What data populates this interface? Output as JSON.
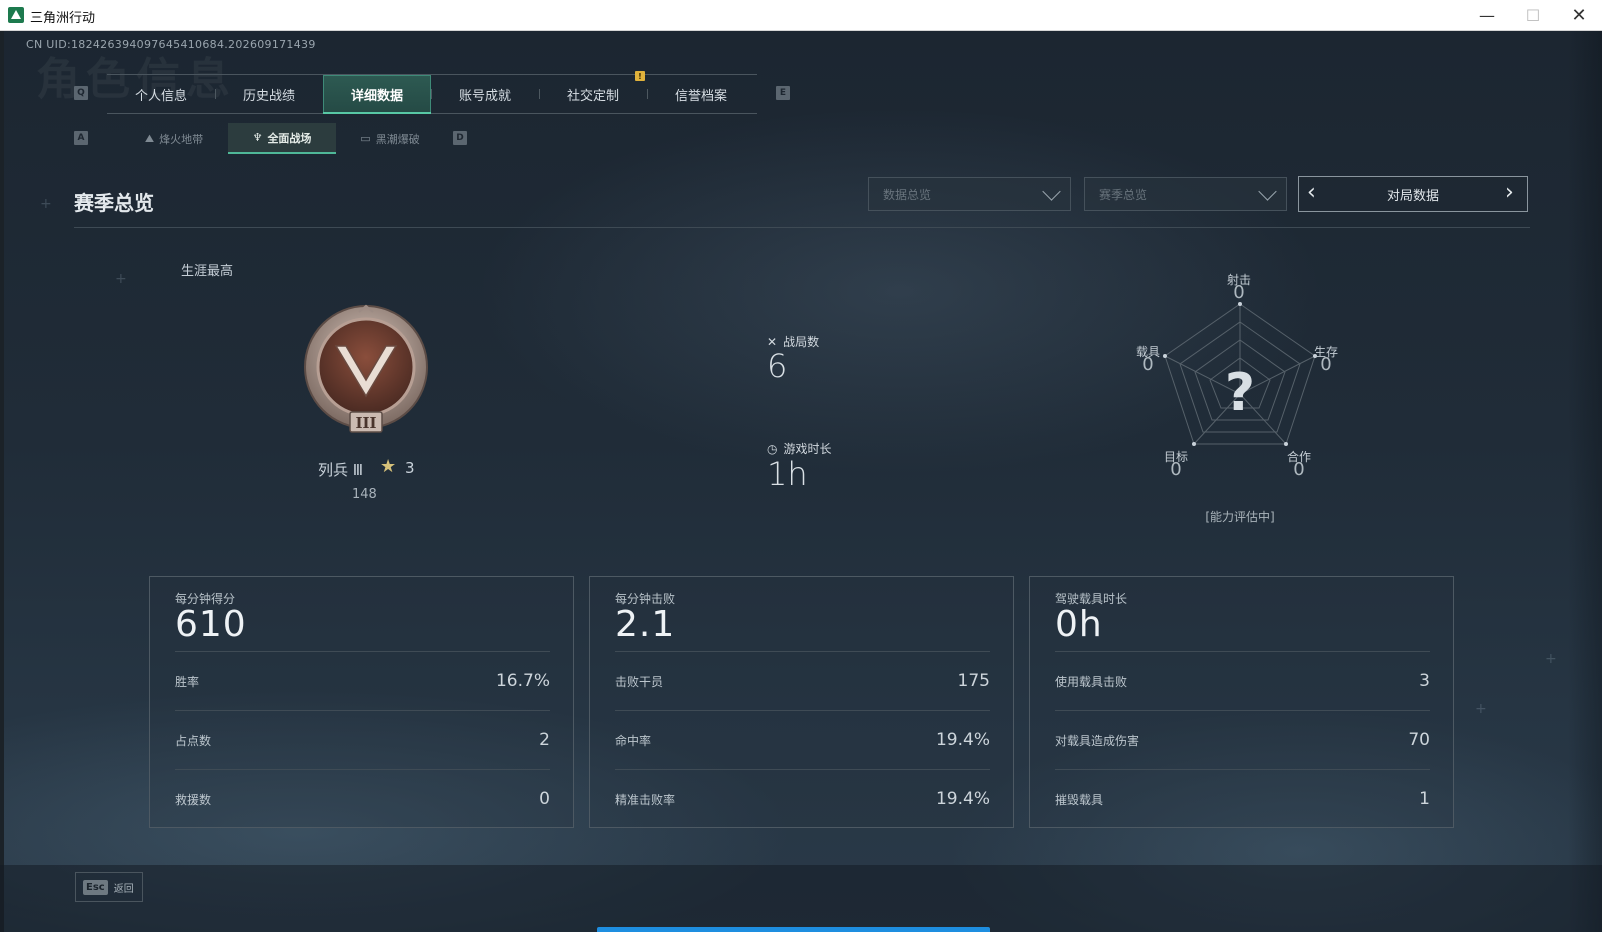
{
  "window": {
    "title": "三角洲行动",
    "minimize": "—",
    "maximize": "☐",
    "close": "✕"
  },
  "header": {
    "uid": "CN UID:1824263940976454106​84.202609171439",
    "ghost_title": "角色信息"
  },
  "key_hints": {
    "prev_tab": "Q",
    "next_tab": "E",
    "prev_sub": "A",
    "next_sub": "D"
  },
  "tabs": [
    {
      "label": "个人信息",
      "active": false
    },
    {
      "label": "历史战绩",
      "active": false
    },
    {
      "label": "详细数据",
      "active": true
    },
    {
      "label": "账号成就",
      "active": false
    },
    {
      "label": "社交定制",
      "active": false
    },
    {
      "label": "信誉档案",
      "active": false
    }
  ],
  "tab_badge": "!",
  "subtabs": [
    {
      "label": "烽火地带",
      "icon": "mountain-icon",
      "active": false
    },
    {
      "label": "全面战场",
      "icon": "tower-icon",
      "active": true
    },
    {
      "label": "黑潮爆破",
      "icon": "map-icon",
      "active": false
    }
  ],
  "section": {
    "title": "赛季总览",
    "dropdown1": "数据总览",
    "dropdown2": "赛季总览",
    "pager_label": "对局数据"
  },
  "rank": {
    "career_label": "生涯最高",
    "name": "列兵 Ⅲ",
    "stars": "3",
    "score": "148",
    "medal_numeral": "III"
  },
  "middle": {
    "matches_label": "战局数",
    "matches_value": "6",
    "time_label": "游戏时长",
    "time_value": "1h"
  },
  "radar": {
    "center": "?",
    "status": "[能力评估中]",
    "axes": [
      {
        "label": "射击",
        "value": "0"
      },
      {
        "label": "生存",
        "value": "0"
      },
      {
        "label": "合作",
        "value": "0"
      },
      {
        "label": "目标",
        "value": "0"
      },
      {
        "label": "载具",
        "value": "0"
      }
    ]
  },
  "cards": [
    {
      "title": "每分钟得分",
      "big": "610",
      "rows": [
        {
          "label": "胜率",
          "value": "16.7%"
        },
        {
          "label": "占点数",
          "value": "2"
        },
        {
          "label": "救援数",
          "value": "0"
        }
      ]
    },
    {
      "title": "每分钟击败",
      "big": "2.1",
      "rows": [
        {
          "label": "击败干员",
          "value": "175"
        },
        {
          "label": "命中率",
          "value": "19.4%"
        },
        {
          "label": "精准击败率",
          "value": "19.4%"
        }
      ]
    },
    {
      "title": "驾驶载具时长",
      "big": "0h",
      "rows": [
        {
          "label": "使用载具击败",
          "value": "3"
        },
        {
          "label": "对载具造成伤害",
          "value": "70"
        },
        {
          "label": "摧毁载具",
          "value": "1"
        }
      ]
    }
  ],
  "footer": {
    "esc_key": "Esc",
    "esc_label": "返回"
  }
}
